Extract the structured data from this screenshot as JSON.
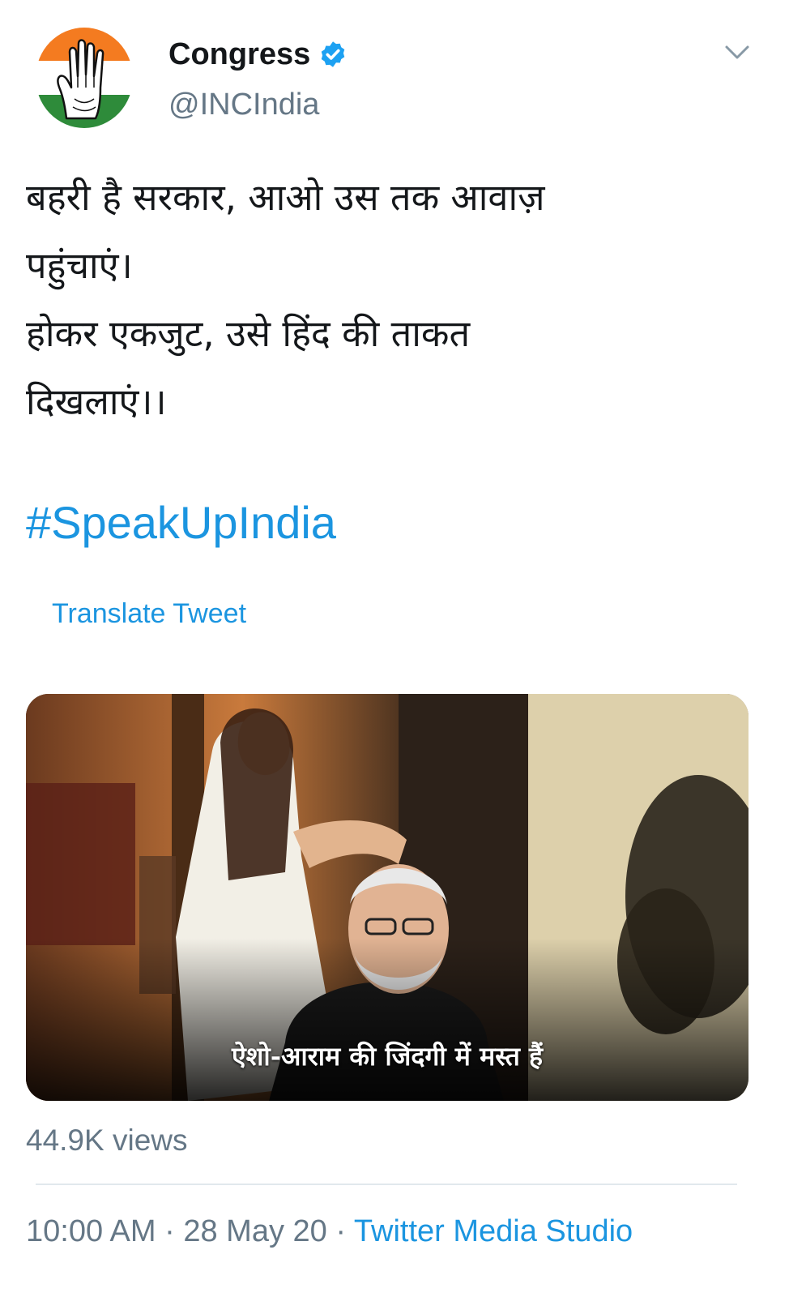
{
  "author": {
    "display_name": "Congress",
    "handle": "@INCIndia",
    "avatar_icon": "congress-hand-logo",
    "verified_icon": "verified-badge-icon"
  },
  "tweet": {
    "lines": [
      "बहरी है सरकार, आओ उस तक आवाज़",
      "पहुंचाएं।",
      "होकर एकजुट, उसे हिंद की ताकत",
      "दिखलाएं।।"
    ],
    "hashtag": "#SpeakUpIndia",
    "translate_label": "Translate Tweet"
  },
  "media": {
    "subtitle": "ऐशो-आराम की जिंदगी में मस्त हैं"
  },
  "stats": {
    "views": "44.9K views"
  },
  "meta": {
    "time": "10:00 AM",
    "separator": " · ",
    "date": "28 May 20",
    "source": "Twitter Media Studio"
  },
  "colors": {
    "link": "#1b95e0",
    "secondary_text": "#657786",
    "verified": "#1da1f2",
    "saffron": "#f47b20",
    "green": "#2e8b3a"
  }
}
